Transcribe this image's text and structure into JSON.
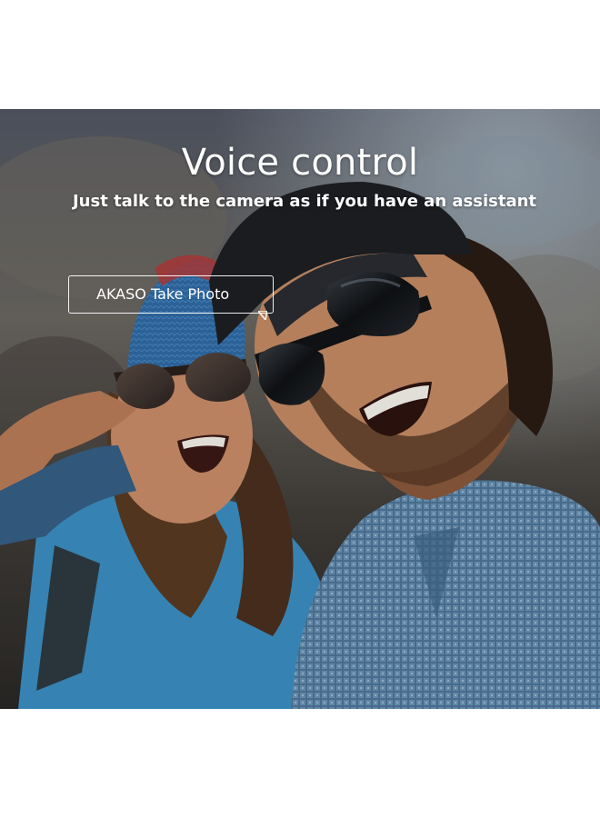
{
  "overlay": {
    "title": "Voice control",
    "subtitle": "Just talk to the camera as if you have an assistant",
    "voice_command": "AKASO Take Photo"
  },
  "scene": {
    "description_icon": "photo",
    "colors": {
      "background_top": "#4b5160",
      "hat_blue": "#2f6fa8",
      "shirt_blue": "#3a8ec2",
      "plaid_shirt": "#5e86a8",
      "skin": "#c98f6b",
      "hair": "#4a2f1e",
      "cap": "#1c1e22"
    }
  }
}
